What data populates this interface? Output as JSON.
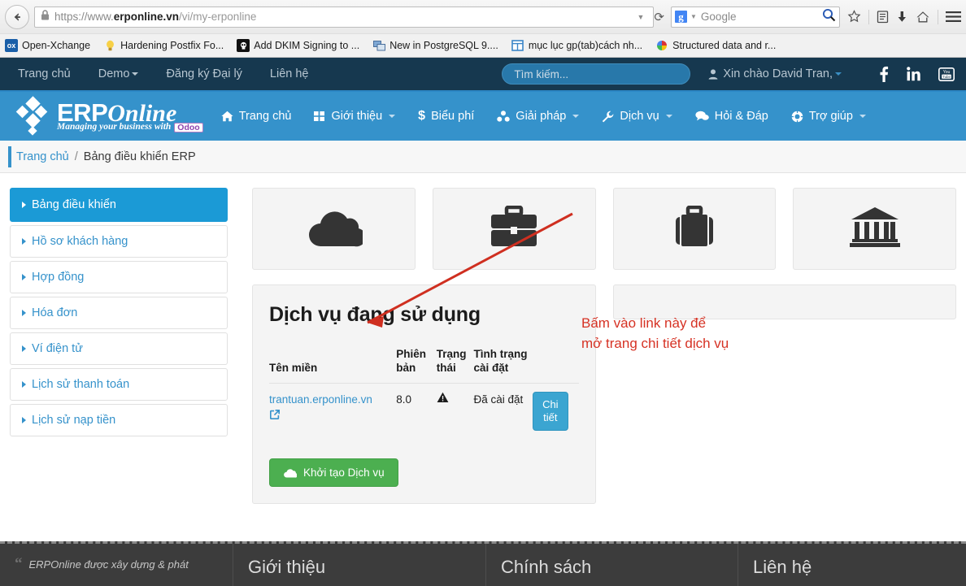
{
  "browser": {
    "back_icon": "back-arrow-icon",
    "lock_icon": "lock-icon",
    "url_prefix": "https://www.",
    "url_domain": "erponline.vn",
    "url_path": "/vi/my-erponline",
    "url_dropdown_icon": "chevron-down-icon",
    "reload_icon": "reload-icon",
    "search_engine": "Google",
    "search_engine_logo": "google-g-logo",
    "search_icon": "magnifier-icon",
    "toolbar_icons": [
      "bookmark-star-icon",
      "reader-icon",
      "downloads-icon",
      "home-icon",
      "menu-hamburger-icon"
    ],
    "bookmarks": [
      {
        "label": "Open-Xchange",
        "favicon": "ox-icon",
        "favicon_color": "#1a5fa8",
        "favicon_text": "ox"
      },
      {
        "label": "Hardening Postfix Fo...",
        "favicon": "lightbulb-icon",
        "favicon_color": "#f5c518",
        "favicon_text": ""
      },
      {
        "label": "Add DKIM Signing to ...",
        "favicon": "skull-icon",
        "favicon_color": "#111111",
        "favicon_text": ""
      },
      {
        "label": "New in PostgreSQL 9....",
        "favicon": "screens-icon",
        "favicon_color": "#4a7ab5",
        "favicon_text": ""
      },
      {
        "label": "mục lục gp(tab)cách nh...",
        "favicon": "window-icon",
        "favicon_color": "#ffffff",
        "favicon_text": ""
      },
      {
        "label": "Structured data and r...",
        "favicon": "google-icon",
        "favicon_color": "#ffffff",
        "favicon_text": ""
      }
    ]
  },
  "topbar": {
    "links": [
      {
        "label": "Trang chủ",
        "has_caret": false
      },
      {
        "label": "Demo",
        "has_caret": true
      },
      {
        "label": "Đăng ký Đại lý",
        "has_caret": false
      },
      {
        "label": "Liên hệ",
        "has_caret": false
      }
    ],
    "search_placeholder": "Tìm kiếm...",
    "greeting": "Xin chào David Tran,",
    "user_icon": "user-icon",
    "social": [
      {
        "name": "facebook-icon",
        "glyph": "f"
      },
      {
        "name": "linkedin-icon",
        "glyph": "in"
      },
      {
        "name": "youtube-icon",
        "glyph": "You Tube"
      }
    ]
  },
  "brand": {
    "name_primary": "ERP",
    "name_secondary": "Online",
    "tagline": "Managing your business with",
    "tagline_badge": "Odoo",
    "logo_icon": "erponline-diamond-logo"
  },
  "mainnav": {
    "items": [
      {
        "label": "Trang chủ",
        "icon": "home-icon",
        "glyph": "⌂",
        "caret": false
      },
      {
        "label": "Giới thiệu",
        "icon": "grid-icon",
        "glyph": "▣",
        "caret": true
      },
      {
        "label": "Biểu phí",
        "icon": "dollar-icon",
        "glyph": "$",
        "caret": false
      },
      {
        "label": "Giải pháp",
        "icon": "sitemap-icon",
        "glyph": "☸",
        "caret": true
      },
      {
        "label": "Dịch vụ",
        "icon": "wrench-icon",
        "glyph": "ὒ7",
        "caret": true
      },
      {
        "label": "Hỏi & Đáp",
        "icon": "comments-icon",
        "glyph": "ὊC",
        "caret": false
      },
      {
        "label": "Trợ giúp",
        "icon": "lifebuoy-icon",
        "glyph": "⊕",
        "caret": true
      }
    ]
  },
  "breadcrumb": {
    "home": "Trang chủ",
    "separator": "/",
    "current": "Bảng điều khiển ERP"
  },
  "sidebar": {
    "items": [
      {
        "label": "Bảng điều khiển",
        "active": true
      },
      {
        "label": "Hồ sơ khách hàng",
        "active": false
      },
      {
        "label": "Hợp đồng",
        "active": false
      },
      {
        "label": "Hóa đơn",
        "active": false
      },
      {
        "label": "Ví điện tử",
        "active": false
      },
      {
        "label": "Lịch sử thanh toán",
        "active": false
      },
      {
        "label": "Lịch sử nạp tiền",
        "active": false
      }
    ]
  },
  "cards": [
    {
      "icon": "cloud-icon"
    },
    {
      "icon": "briefcase-icon"
    },
    {
      "icon": "suitcase-icon"
    },
    {
      "icon": "bank-icon"
    }
  ],
  "services_panel": {
    "title": "Dịch vụ đang sử dụng",
    "columns": [
      "Tên miền",
      "Phiên bản",
      "Trạng thái",
      "Tình trạng cài đặt",
      ""
    ],
    "rows": [
      {
        "domain": "trantuan.erponline.vn",
        "external_link_icon": "external-link-icon",
        "version": "8.0",
        "status_icon": "warning-triangle-icon",
        "install_state": "Đã cài đặt",
        "action_label": "Chi tiết"
      }
    ],
    "create_button": "Khởi tạo Dịch vụ",
    "create_button_icon": "cloud-icon"
  },
  "annotation": {
    "line1": "Bấm vào link này để",
    "line2": "mở trang chi tiết dịch vụ",
    "color": "#d63224",
    "arrow_icon": "red-arrow-icon"
  },
  "footer": {
    "quote_mark": "“",
    "quote_text": "ERPOnline được xây dựng & phát",
    "columns": [
      "Giới thiệu",
      "Chính sách",
      "Liên hệ"
    ]
  }
}
